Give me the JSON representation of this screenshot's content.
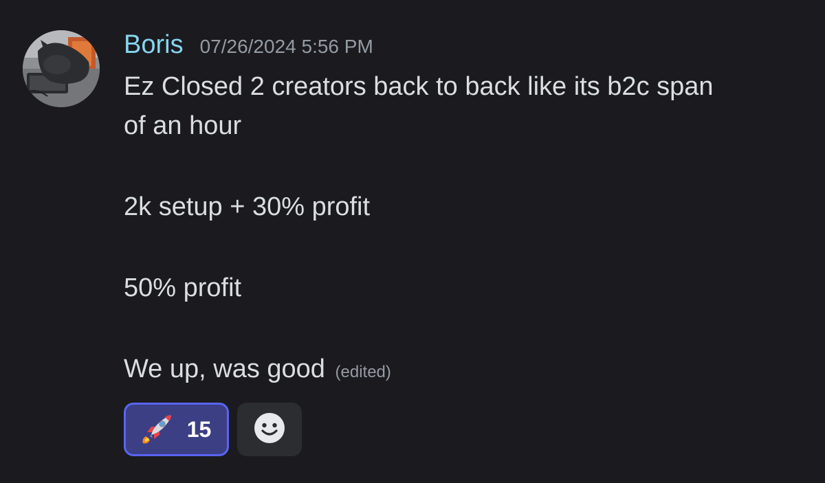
{
  "message": {
    "author": "Boris",
    "timestamp": "07/26/2024 5:56 PM",
    "lines": [
      "Ez Closed 2 creators back to back like its b2c span",
      "of an hour",
      "2k setup + 30% profit",
      "50% profit",
      "We up, was good"
    ],
    "edited_label": "(edited)"
  },
  "reactions": [
    {
      "emoji": "rocket-icon",
      "count": "15",
      "selected": true
    }
  ],
  "add_reaction": {
    "icon": "smiley-icon"
  },
  "colors": {
    "background": "#1b1b1f",
    "username": "#87d5ef",
    "timestamp": "#949ba4",
    "text": "#dbdee1",
    "reaction_border": "#5865f2",
    "reaction_bg": "#3c3f84",
    "add_reaction_bg": "#2b2d31"
  }
}
